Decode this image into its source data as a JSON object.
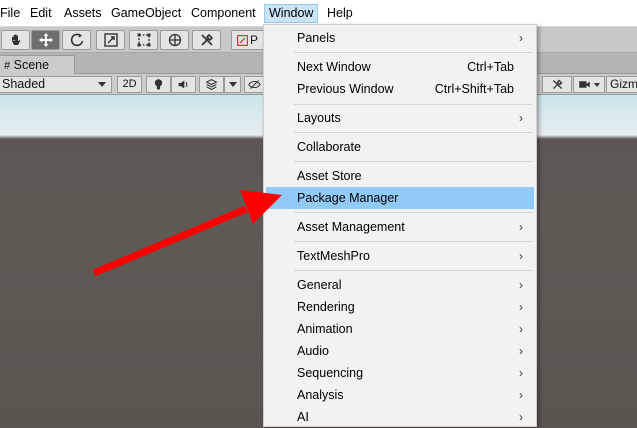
{
  "menubar": {
    "items": [
      "File",
      "Edit",
      "Assets",
      "GameObject",
      "Component",
      "Window",
      "Help"
    ],
    "active": "Window"
  },
  "toolbar": {
    "tools": [
      "hand-tool-icon",
      "move-tool-icon",
      "rotate-tool-icon",
      "scale-tool-icon",
      "rect-tool-icon",
      "transform-tool-icon",
      "custom-tool-icon"
    ],
    "pivot_label": "P"
  },
  "scene": {
    "tab_label": "Scene",
    "shading_mode": "Shaded",
    "mode_2d": "2D",
    "gizmos_label": "Gizm"
  },
  "window_menu": {
    "items": [
      {
        "label": "Panels",
        "shortcut": "",
        "submenu": "›"
      },
      {
        "label": "Next Window",
        "shortcut": "Ctrl+Tab",
        "submenu": ""
      },
      {
        "label": "Previous Window",
        "shortcut": "Ctrl+Shift+Tab",
        "submenu": ""
      },
      {
        "label": "Layouts",
        "shortcut": "",
        "submenu": "›"
      },
      {
        "label": "Collaborate",
        "shortcut": "",
        "submenu": ""
      },
      {
        "label": "Asset Store",
        "shortcut": "",
        "submenu": ""
      },
      {
        "label": "Package Manager",
        "shortcut": "",
        "submenu": ""
      },
      {
        "label": "Asset Management",
        "shortcut": "",
        "submenu": "›"
      },
      {
        "label": "TextMeshPro",
        "shortcut": "",
        "submenu": "›"
      },
      {
        "label": "General",
        "shortcut": "",
        "submenu": "›"
      },
      {
        "label": "Rendering",
        "shortcut": "",
        "submenu": "›"
      },
      {
        "label": "Animation",
        "shortcut": "",
        "submenu": "›"
      },
      {
        "label": "Audio",
        "shortcut": "",
        "submenu": "›"
      },
      {
        "label": "Sequencing",
        "shortcut": "",
        "submenu": "›"
      },
      {
        "label": "Analysis",
        "shortcut": "",
        "submenu": "›"
      },
      {
        "label": "AI",
        "shortcut": "",
        "submenu": "›"
      }
    ],
    "highlighted": "Package Manager"
  },
  "colors": {
    "highlight": "#91c9f7",
    "annotation_arrow": "#ff0000"
  }
}
